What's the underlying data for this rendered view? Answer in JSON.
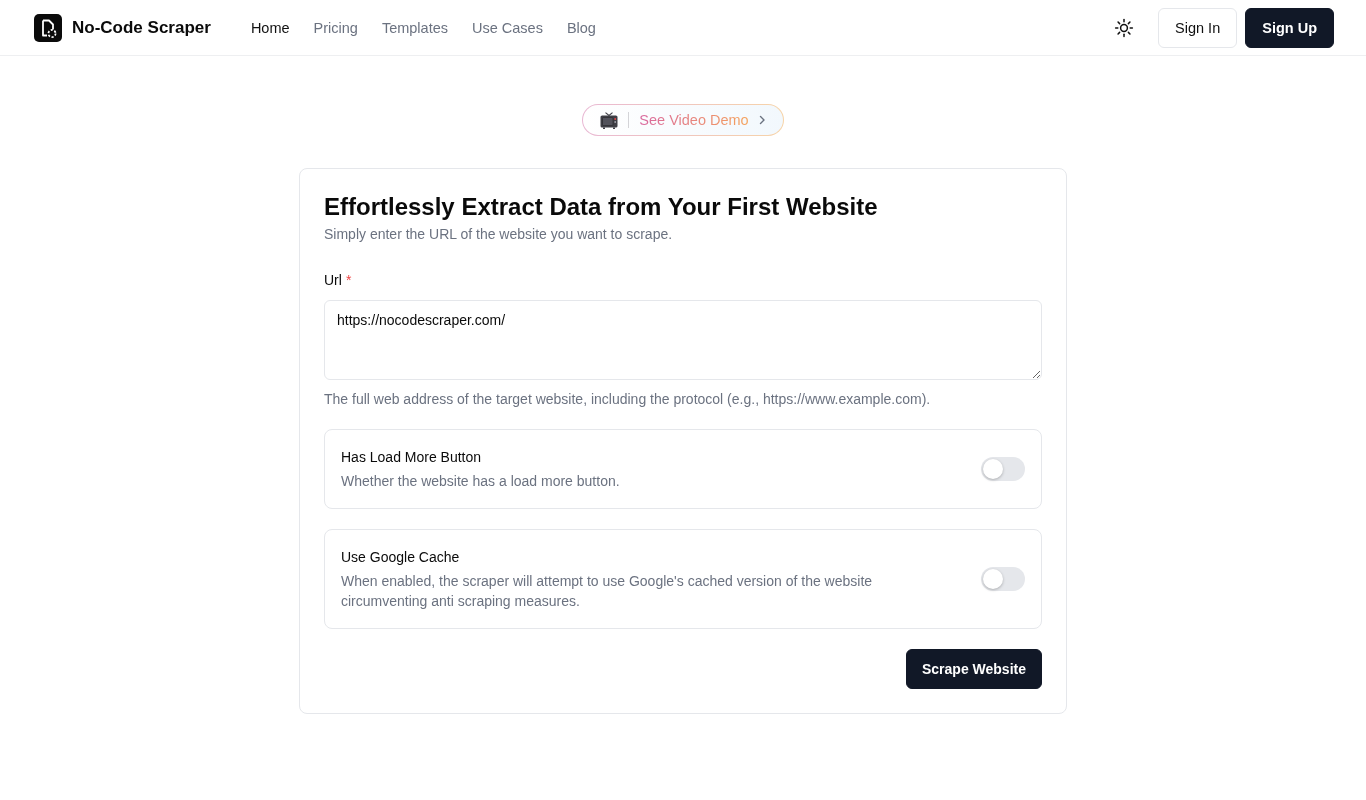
{
  "header": {
    "brand": "No-Code Scraper",
    "nav": [
      {
        "label": "Home",
        "selected": true
      },
      {
        "label": "Pricing",
        "selected": false
      },
      {
        "label": "Templates",
        "selected": false
      },
      {
        "label": "Use Cases",
        "selected": false
      },
      {
        "label": "Blog",
        "selected": false
      }
    ],
    "buttons": [
      {
        "label": "Sign In",
        "kind": "outline"
      },
      {
        "label": "Sign Up",
        "kind": "solid"
      }
    ]
  },
  "promo": {
    "label": "See Video Demo"
  },
  "form": {
    "title": "Effortlessly Extract Data from Your First Website",
    "subtitle": "Simply enter the URL of the website you want to scrape.",
    "url_field": {
      "label": "Url",
      "required_mark": "*",
      "value": "https://nocodescraper.com/",
      "help": "The full web address of the target website, including the protocol (e.g., https://www.example.com)."
    },
    "options": [
      {
        "title": "Has Load More Button",
        "description": "Whether the website has a load more button.",
        "on": false
      },
      {
        "title": "Use Google Cache",
        "description": "When enabled, the scraper will attempt to use Google's cached version of the website circumventing anti scraping measures.",
        "on": false
      }
    ],
    "submit": "Scrape Website"
  }
}
